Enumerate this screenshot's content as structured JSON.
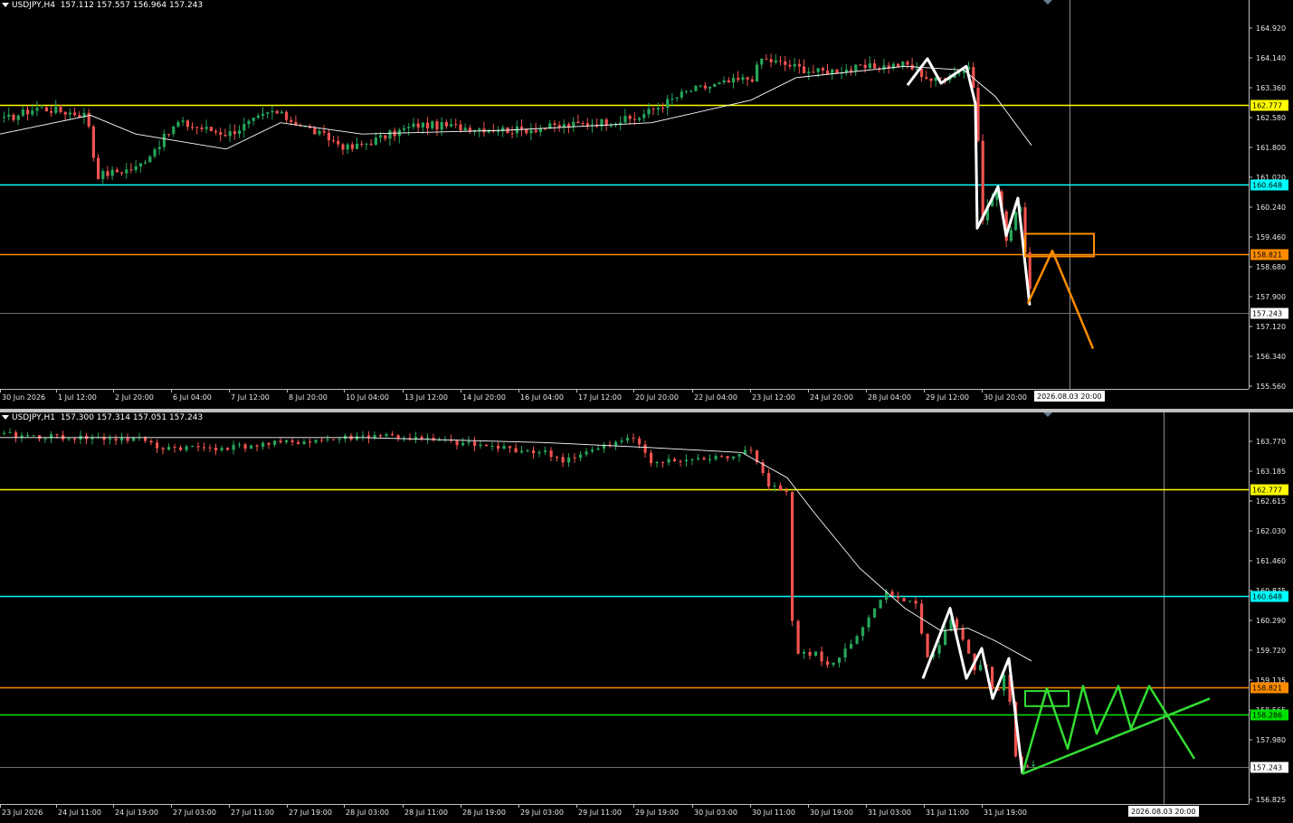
{
  "chart_data": [
    {
      "type": "candlestick",
      "header": {
        "symbol_tf": "USDJPY,H4",
        "ohlc": "157.112 157.557 156.964 157.243"
      },
      "y_ticks": [
        "164.920",
        "164.140",
        "163.360",
        "162.580",
        "161.800",
        "161.020",
        "160.240",
        "159.460",
        "158.680",
        "157.900",
        "157.120",
        "156.340",
        "155.560"
      ],
      "ylim": [
        155.23,
        165.56
      ],
      "x_ticks": [
        "30 Jun 2026",
        "1 Jul 12:00",
        "2 Jul 20:00",
        "6 Jul 04:00",
        "7 Jul 12:00",
        "8 Jul 20:00",
        "10 Jul 04:00",
        "13 Jul 12:00",
        "14 Jul 20:00",
        "16 Jul 04:00",
        "17 Jul 12:00",
        "20 Jul 20:00",
        "22 Jul 04:00",
        "23 Jul 12:00",
        "24 Jul 20:00",
        "28 Jul 04:00",
        "29 Jul 12:00",
        "30 Jul 20:00"
      ],
      "levels": [
        {
          "value": 162.777,
          "label": "162.777",
          "color": "#ffff00"
        },
        {
          "value": 160.648,
          "label": "160.648",
          "color": "#00ffff"
        },
        {
          "value": 158.821,
          "label": "158.821",
          "color": "#ff8c00"
        }
      ],
      "current_price": {
        "value": 157.243,
        "label": "157.243"
      },
      "crosshair_time": "2026.08.03 20:00",
      "colors": {
        "bull": "#26a65b",
        "bear": "#ef5350",
        "ma": "#ffffff",
        "zigzag": "#ffffff",
        "projection": "#ff8c00"
      },
      "projection_box": {
        "low": 158.75,
        "high": 159.35
      }
    },
    {
      "type": "candlestick",
      "header": {
        "symbol_tf": "USDJPY,H1",
        "ohlc": "157.300 157.314 157.051 157.243"
      },
      "y_ticks": [
        "163.770",
        "163.185",
        "162.615",
        "162.030",
        "161.460",
        "160.875",
        "160.290",
        "159.720",
        "159.135",
        "158.565",
        "157.980",
        "157.395",
        "156.825"
      ],
      "ylim": [
        156.5,
        164.3
      ],
      "x_ticks": [
        "23 Jul 2026",
        "24 Jul 11:00",
        "24 Jul 19:00",
        "27 Jul 03:00",
        "27 Jul 11:00",
        "27 Jul 19:00",
        "28 Jul 03:00",
        "28 Jul 11:00",
        "28 Jul 19:00",
        "29 Jul 03:00",
        "29 Jul 11:00",
        "29 Jul 19:00",
        "30 Jul 03:00",
        "30 Jul 11:00",
        "30 Jul 19:00",
        "31 Jul 03:00",
        "31 Jul 11:00",
        "31 Jul 19:00"
      ],
      "levels": [
        {
          "value": 162.777,
          "label": "162.777",
          "color": "#ffff00"
        },
        {
          "value": 160.648,
          "label": "160.648",
          "color": "#00ffff"
        },
        {
          "value": 158.821,
          "label": "158.821",
          "color": "#ff8c00"
        },
        {
          "value": 158.286,
          "label": "158.286",
          "color": "#00e000"
        }
      ],
      "current_price": {
        "value": 157.243,
        "label": "157.243"
      },
      "crosshair_time": "2026.08.03 20:00",
      "colors": {
        "bull": "#26a65b",
        "bear": "#ef5350",
        "ma": "#ffffff",
        "zigzag": "#ffffff",
        "projection": "#33dd33"
      },
      "projection_box": {
        "low": 158.45,
        "high": 158.75
      }
    }
  ]
}
